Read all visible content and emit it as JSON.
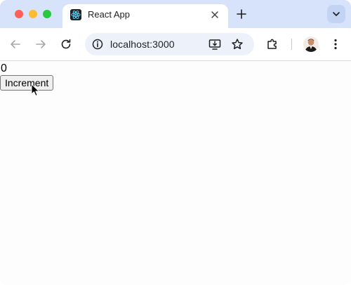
{
  "browser": {
    "tab": {
      "title": "React App",
      "favicon": "react-icon"
    },
    "address_bar": {
      "url": "localhost:3000"
    },
    "icons": {
      "back": "arrow-left-icon",
      "forward": "arrow-right-icon",
      "reload": "reload-icon",
      "site_info": "info-icon",
      "install": "install-app-icon",
      "bookmark": "star-icon",
      "extensions": "puzzle-icon",
      "menu": "kebab-menu-icon",
      "new_tab": "plus-icon",
      "tab_search": "chevron-down-icon",
      "tab_close": "close-icon"
    },
    "colors": {
      "tabstrip": "#d6e3fb",
      "omnibox": "#edf2fa",
      "close": "#ff5f57",
      "minimize": "#febc2e",
      "maximize": "#28c840"
    }
  },
  "app": {
    "count": "0",
    "increment_label": "Increment"
  }
}
